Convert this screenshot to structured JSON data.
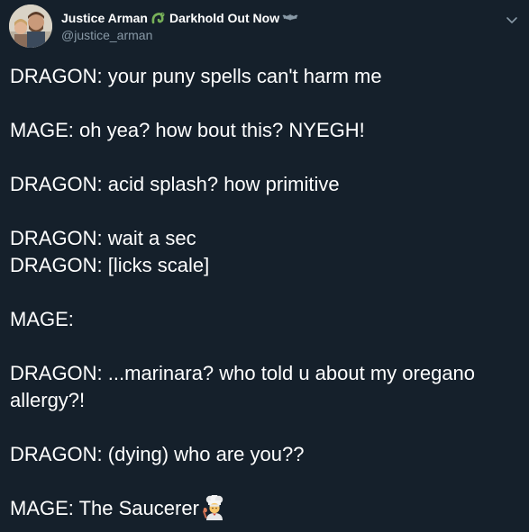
{
  "author": {
    "name_part1": "Justice Arman",
    "name_part2": "Darkhold Out Now",
    "handle": "@justice_arman",
    "name_icons": [
      "worm-icon",
      "bat-icon"
    ]
  },
  "tweet": {
    "lines": [
      "DRAGON: your puny spells can't harm me",
      "MAGE: oh yea? how bout this? NYEGH!",
      "DRAGON: acid splash? how primitive",
      "DRAGON: wait a sec",
      "DRAGON: [licks scale]",
      "MAGE:",
      "DRAGON: ...marinara? who told u about my oregano allergy?!",
      "DRAGON: (dying) who are you??",
      "MAGE: The Saucerer"
    ],
    "trailing_emoji": "cook-emoji"
  },
  "colors": {
    "background": "#15202b",
    "text": "#ffffff",
    "secondary_text": "#8899a6",
    "worm_green": "#78b159"
  }
}
